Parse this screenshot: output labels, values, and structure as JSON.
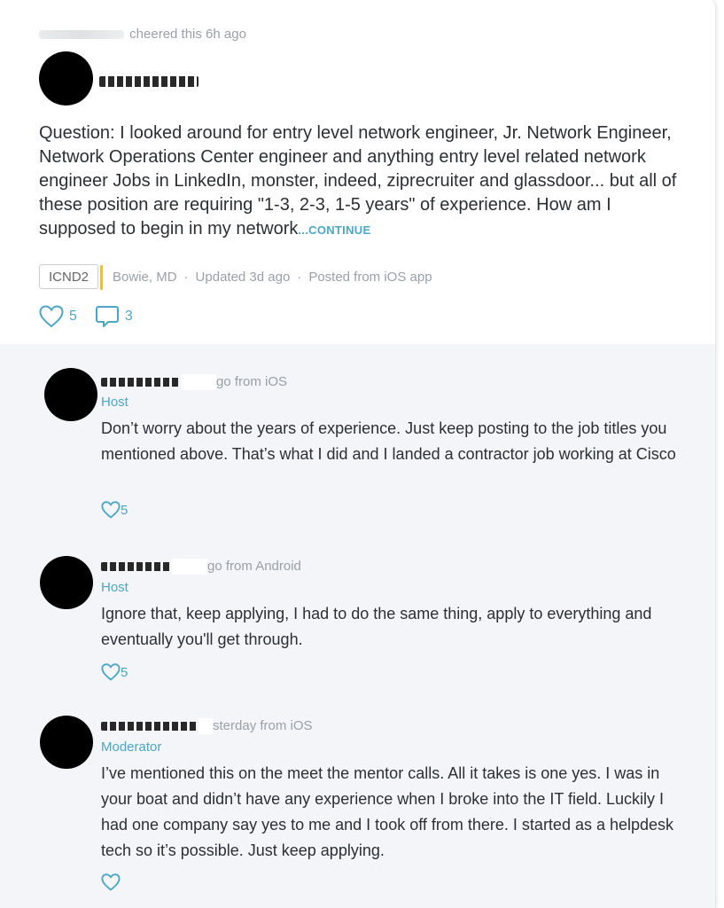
{
  "post": {
    "activity_suffix": "cheered this 6h ago",
    "body": "Question: I looked around for entry level network engineer, Jr. Network Engineer, Network Operations Center engineer and anything entry level related network engineer Jobs in LinkedIn, monster, indeed, ziprecruiter and glassdoor... but all of these position are requiring \"1-3, 2-3, 1-5 years\" of experience. How am I supposed to begin in my network",
    "continue_label": "...CONTINUE",
    "tag": "ICND2",
    "location": "Bowie, MD",
    "updated": "Updated 3d ago",
    "posted_from": "Posted from iOS app",
    "likes": "5",
    "comments": "3",
    "accent_color": "#4aa7c9",
    "tag_accent_color": "#f5c026"
  },
  "comments": [
    {
      "meta_suffix": "go from iOS",
      "role": "Host",
      "text": "Don’t worry about the years of experience. Just keep posting to the job titles you mentioned above. That’s what I did and I landed a contractor job working at Cisco",
      "likes": "5"
    },
    {
      "meta_suffix": "go from Android",
      "role": "Host",
      "text": "Ignore that, keep applying, I had to do the same thing, apply to everything and eventually you'll get through.",
      "likes": "5"
    },
    {
      "meta_suffix": "sterday from iOS",
      "role": "Moderator",
      "text": "I’ve mentioned this on the meet the mentor calls. All it takes is one yes. I was in your boat and didn’t have any experience when I broke into the IT field. Luckily I had one company say yes to me and I took off from there. I started as a helpdesk tech so it’s possible. Just keep applying.",
      "likes": ""
    }
  ],
  "icons": [
    "heart-icon",
    "comment-bubble-icon"
  ]
}
